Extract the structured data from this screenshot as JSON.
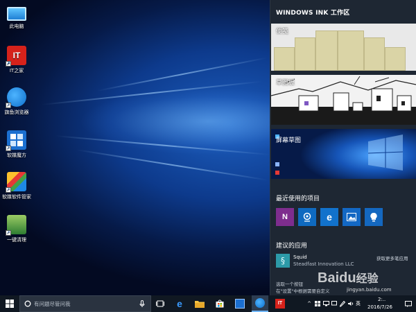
{
  "desktop": {
    "icons": [
      {
        "label": "此电脑",
        "icon": "this-pc-icon"
      },
      {
        "label": "IT之家",
        "icon": "ithome-icon",
        "glyph": "IT"
      },
      {
        "label": "旗鱼浏览器",
        "icon": "sailfish-browser-icon"
      },
      {
        "label": "软媒魔方",
        "icon": "ruanmei-cube-icon"
      },
      {
        "label": "软媒软件管家",
        "icon": "ruanmei-software-manager-icon"
      },
      {
        "label": "一键清理",
        "icon": "one-click-clean-icon"
      }
    ]
  },
  "ink_workspace": {
    "title": "WINDOWS INK 工作区",
    "sticky_notes_label": "便笺",
    "sketchpad_label": "草图板",
    "screen_sketch_label": "屏幕草图",
    "recent_label": "最近使用的项目",
    "recent_apps": [
      {
        "icon": "onenote-icon",
        "glyph": "N"
      },
      {
        "icon": "maps-icon",
        "glyph": "◉"
      },
      {
        "icon": "edge-icon",
        "glyph": "e"
      },
      {
        "icon": "photos-icon",
        "glyph": "▲"
      },
      {
        "icon": "tips-icon",
        "glyph": "💡"
      }
    ],
    "suggested_label": "建议的应用",
    "suggested_app": {
      "name": "Squid",
      "publisher": "Steadfast Innovation LLC",
      "more_link": "获取更多笔应用",
      "icon": "squid-icon"
    },
    "hint_line1": "选取一个按钮",
    "hint_line2": "在\"设置\"中根据需要自定义"
  },
  "watermark": {
    "brand": "Baidu",
    "suffix": "经验",
    "url": "jingyan.baidu.com"
  },
  "taskbar": {
    "search_placeholder": "有问题尽管问我",
    "tray_ime": "英",
    "tray_time": "2:..",
    "tray_date": "2016/7/26"
  },
  "colors": {
    "panel_bg": "#1e2733",
    "taskbar_bg": "#101822",
    "accent": "#1272cc",
    "onenote": "#7e2d8e"
  }
}
